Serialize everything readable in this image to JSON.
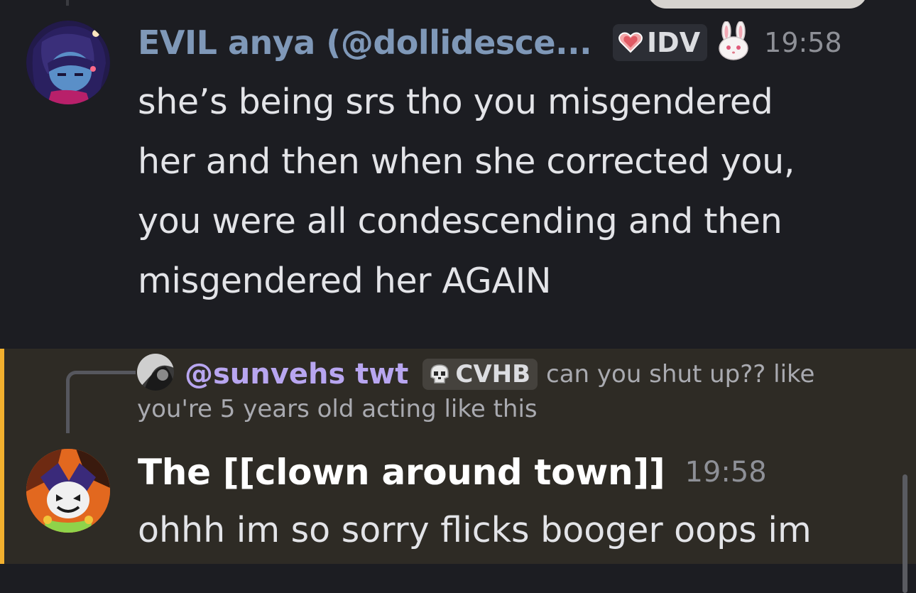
{
  "messages": [
    {
      "author": "EVIL anya (@dollidesce...",
      "tag": "IDV",
      "tag_icon": "heart-icon",
      "badge_icon": "bunny-icon",
      "time": "19:58",
      "lines": [
        "she’s being srs tho you misgendered",
        "her and then when she corrected you,",
        "you were all condescending and then",
        "misgendered her AGAIN"
      ]
    },
    {
      "reply": {
        "author": "@sunvehs twt",
        "tag": "CVHB",
        "tag_icon": "skull-icon",
        "text_line1": "can you shut up?? like",
        "text_line2": "you're 5 years old acting like this"
      },
      "author": "The [[clown around town]]",
      "time": "19:58",
      "text": "ohhh im so sorry flicks booger oops im"
    }
  ],
  "colors": {
    "background": "#1c1d22",
    "highlight": "#2e2b25",
    "highlight_bar": "#f2b02e",
    "username1": "#7f98b8",
    "reply_username": "#b8a6f0"
  }
}
